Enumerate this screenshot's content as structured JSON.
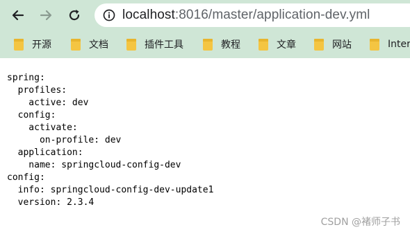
{
  "browser": {
    "url_host": "localhost",
    "url_rest": ":8016/master/application-dev.yml"
  },
  "bookmarks": [
    {
      "label": "开源"
    },
    {
      "label": "文档"
    },
    {
      "label": "插件工具"
    },
    {
      "label": "教程"
    },
    {
      "label": "文章"
    },
    {
      "label": "网站"
    },
    {
      "label": "Inter"
    }
  ],
  "content": {
    "lines": [
      "spring:",
      "  profiles:",
      "    active: dev",
      "  config:",
      "    activate:",
      "      on-profile: dev",
      "  application:",
      "    name: springcloud-config-dev",
      "config:",
      "  info: springcloud-config-dev-update1",
      "  version: 2.3.4"
    ]
  },
  "watermark": "CSDN @褚师子书",
  "colors": {
    "toolbar_bg": "#cfe6d6",
    "folder": "#f4c542"
  }
}
